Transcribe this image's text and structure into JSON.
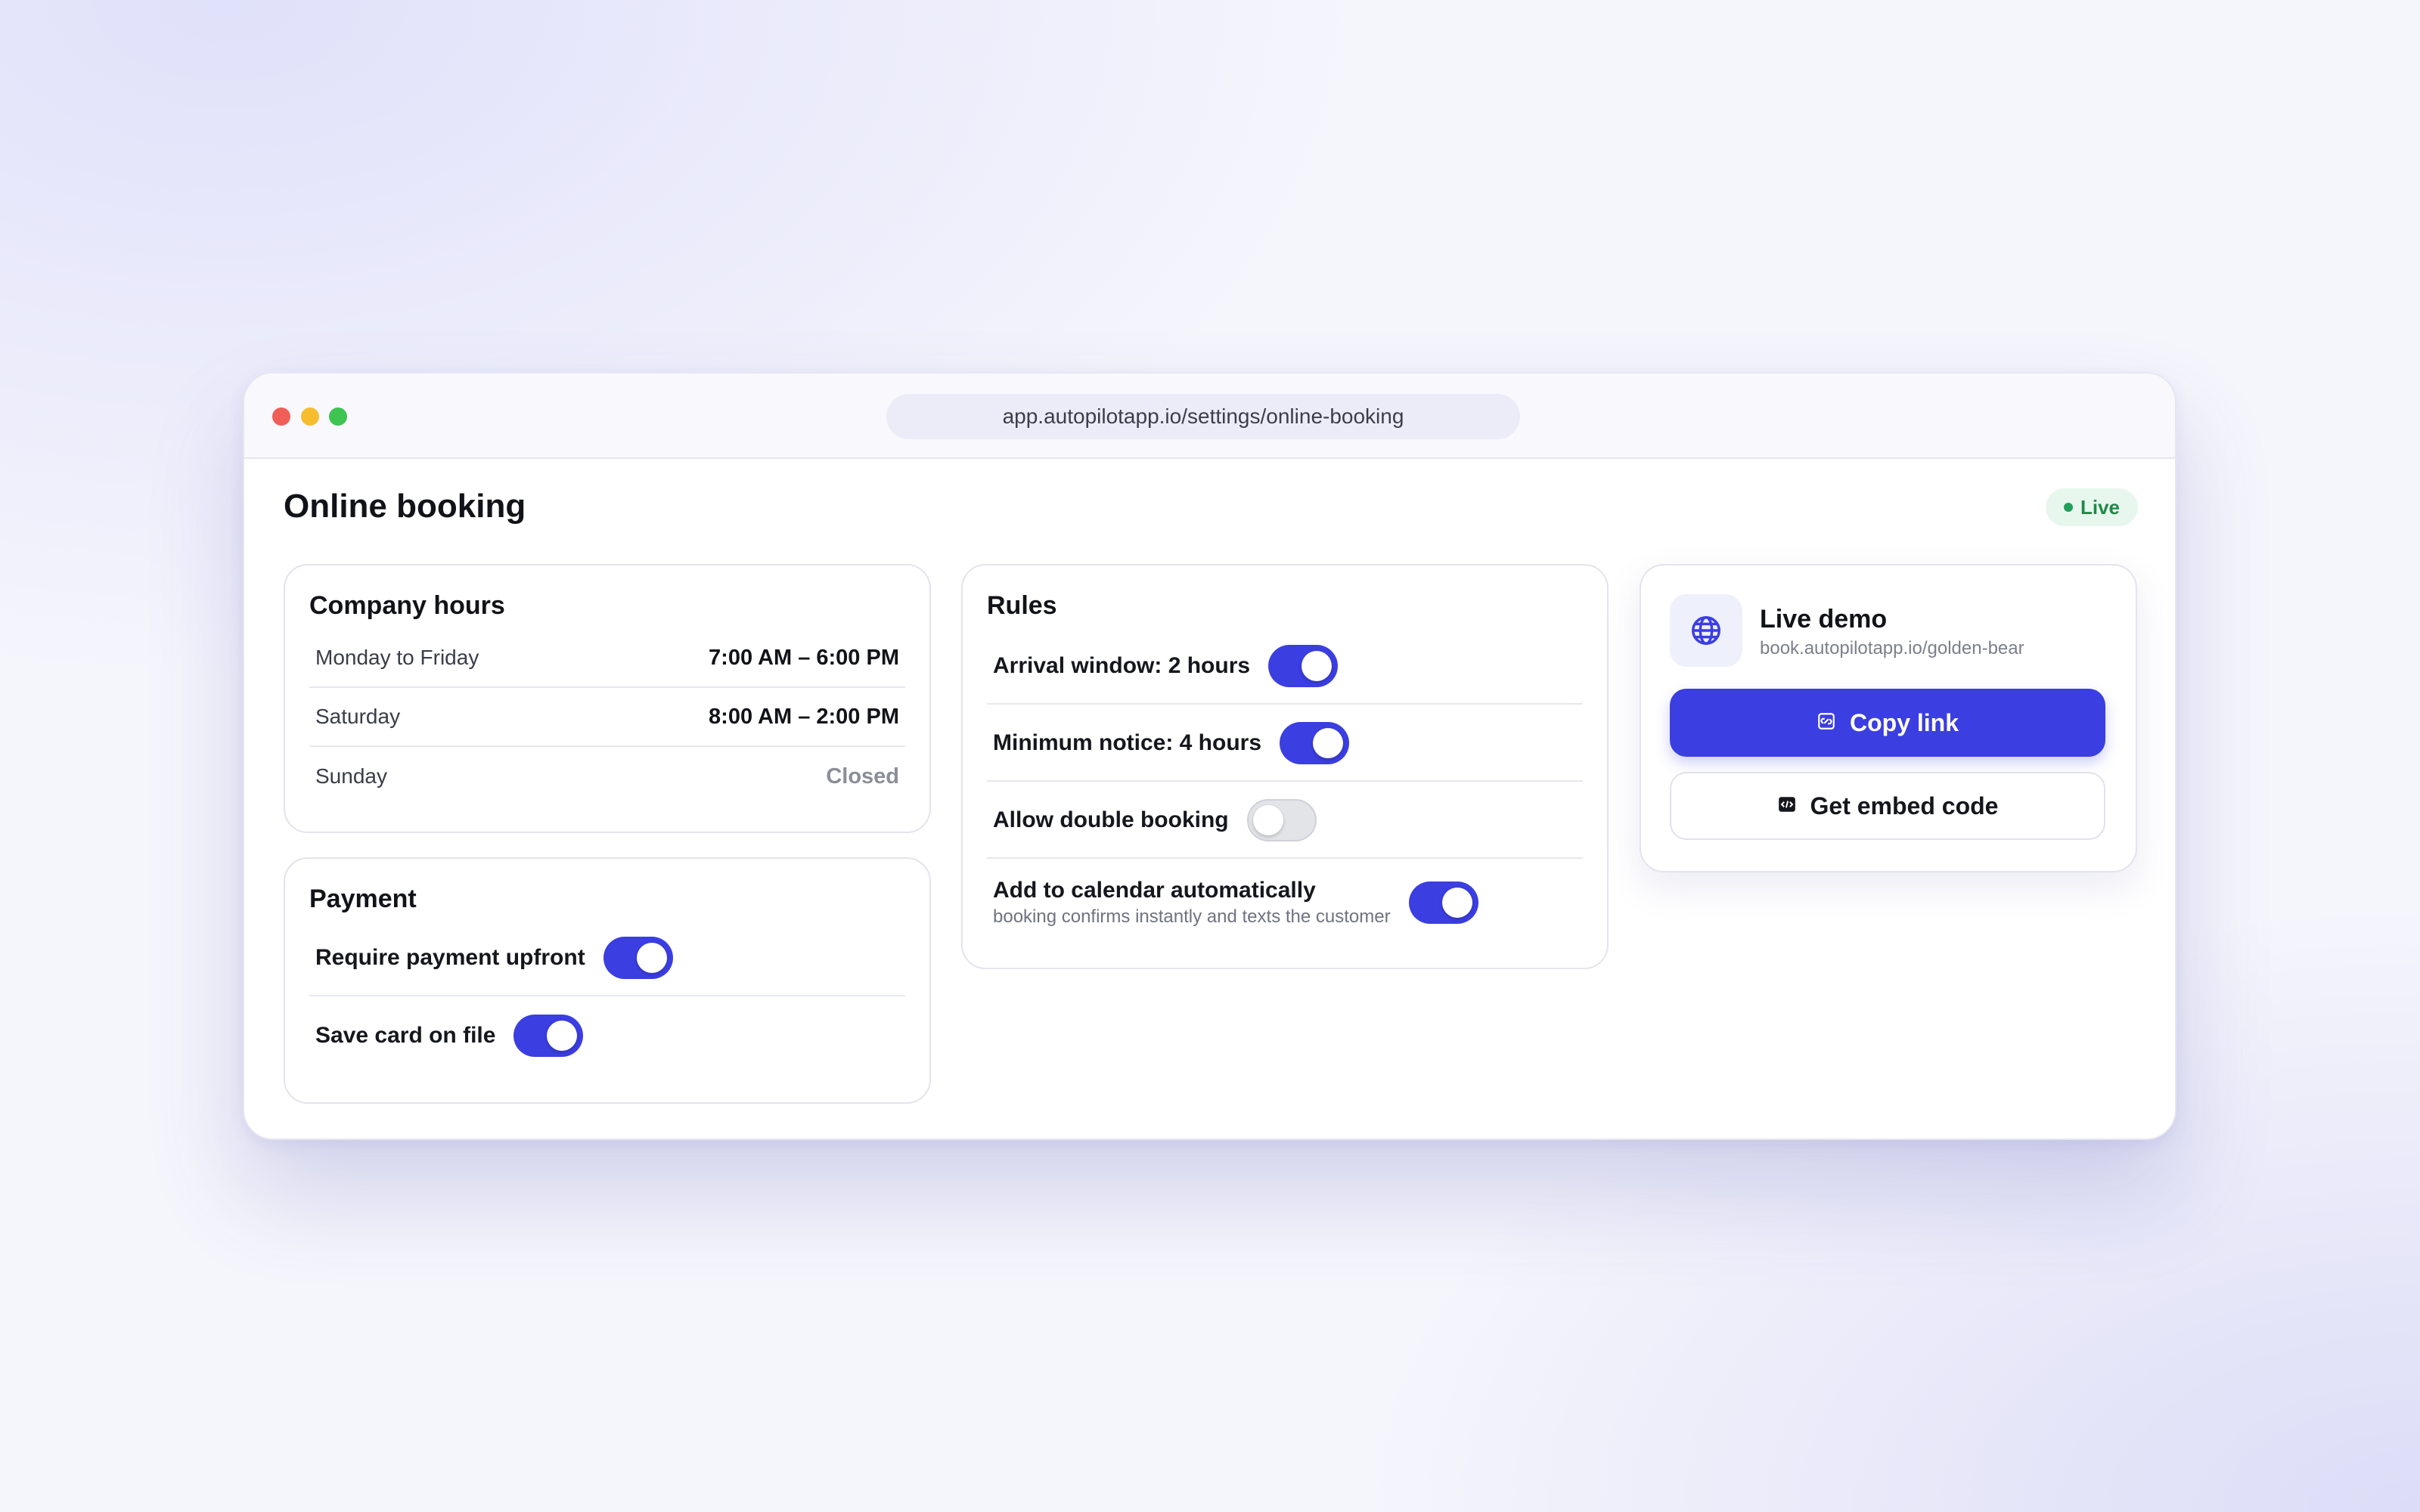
{
  "browser": {
    "url": "app.autopilotapp.io/settings/online-booking"
  },
  "page": {
    "title": "Online booking",
    "status_badge": "Live"
  },
  "company_hours": {
    "title": "Company hours",
    "rows": [
      {
        "day": "Monday to Friday",
        "hours": "7:00 AM – 6:00 PM"
      },
      {
        "day": "Saturday",
        "hours": "8:00 AM – 2:00 PM"
      },
      {
        "day": "Sunday",
        "hours": "Closed"
      }
    ]
  },
  "payment": {
    "title": "Payment",
    "toggles": [
      {
        "label": "Require payment upfront",
        "on": true
      },
      {
        "label": "Save card on file",
        "on": true
      }
    ]
  },
  "rules": {
    "title": "Rules",
    "toggles": [
      {
        "label": "Arrival window: 2 hours",
        "on": true
      },
      {
        "label": "Minimum notice: 4 hours",
        "on": true
      },
      {
        "label": "Allow double booking",
        "on": false
      },
      {
        "label": "Add to calendar automatically",
        "sub": "booking confirms instantly and texts the customer",
        "on": true
      }
    ]
  },
  "live_demo": {
    "title": "Live demo",
    "url": "book.autopilotapp.io/golden-bear",
    "icon": "globe-icon",
    "copy_button": "Copy link",
    "copy_icon": "link-icon",
    "embed_button": "Get embed code",
    "embed_icon": "code-icon"
  },
  "colors": {
    "accent": "#3b3ee0",
    "live_green": "#1f8a47",
    "toggle_off": "#e3e4e8"
  }
}
